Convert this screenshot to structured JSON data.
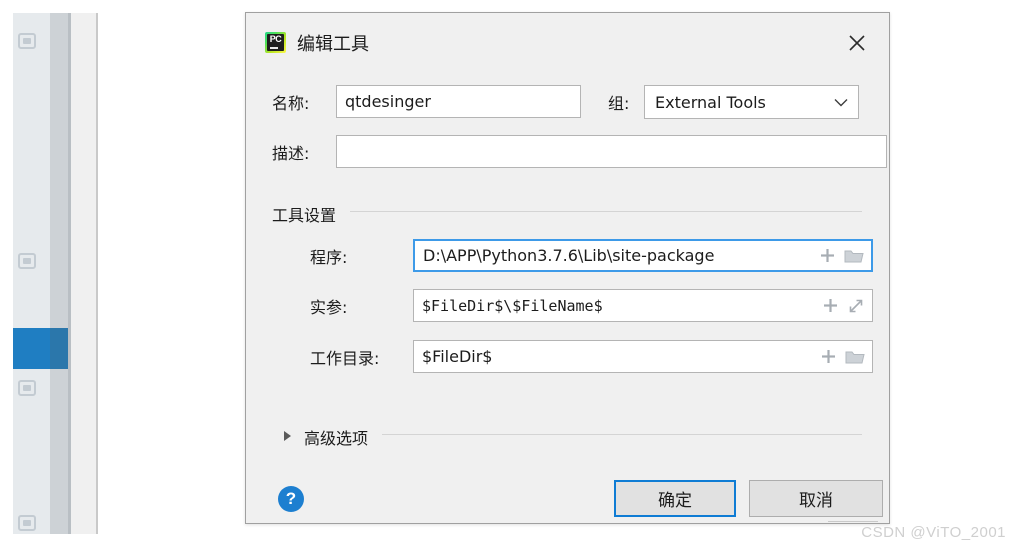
{
  "background_window": {
    "sidebar_icons": [
      "window-icon",
      "window-icon",
      "window-icon",
      "window-icon"
    ],
    "selected_row_color": "#1f7ec2"
  },
  "dialog": {
    "app_icon": "pycharm-icon",
    "app_icon_text": "PC",
    "title": "编辑工具",
    "close_icon": "close-icon",
    "fields": {
      "name_label": "名称:",
      "name_value": "qtdesinger",
      "group_label": "组:",
      "group_value": "External Tools",
      "group_dropdown_icon": "chevron-down-icon",
      "description_label": "描述:",
      "description_value": ""
    },
    "tool_settings": {
      "group_title": "工具设置",
      "program_label": "程序:",
      "program_value": "D:\\APP\\Python3.7.6\\Lib\\site-package",
      "program_icons": [
        "plus-icon",
        "folder-icon"
      ],
      "arguments_label": "实参:",
      "arguments_value": "$FileDir$\\$FileName$",
      "arguments_icons": [
        "plus-icon",
        "expand-icon"
      ],
      "workdir_label": "工作目录:",
      "workdir_value": "$FileDir$",
      "workdir_icons": [
        "plus-icon",
        "folder-icon"
      ]
    },
    "advanced": {
      "label": "高级选项",
      "expand_icon": "triangle-right-icon",
      "expanded": false
    },
    "footer": {
      "help_icon": "help-icon",
      "help_glyph": "?",
      "ok_label": "确定",
      "cancel_label": "取消"
    },
    "colors": {
      "accent": "#1f7ec2",
      "focus_border": "#3d9ae8",
      "default_button_border": "#0f7cd4",
      "dialog_background": "#f0f0f0"
    }
  },
  "watermark": {
    "text": "CSDN @ViTO_2001"
  }
}
